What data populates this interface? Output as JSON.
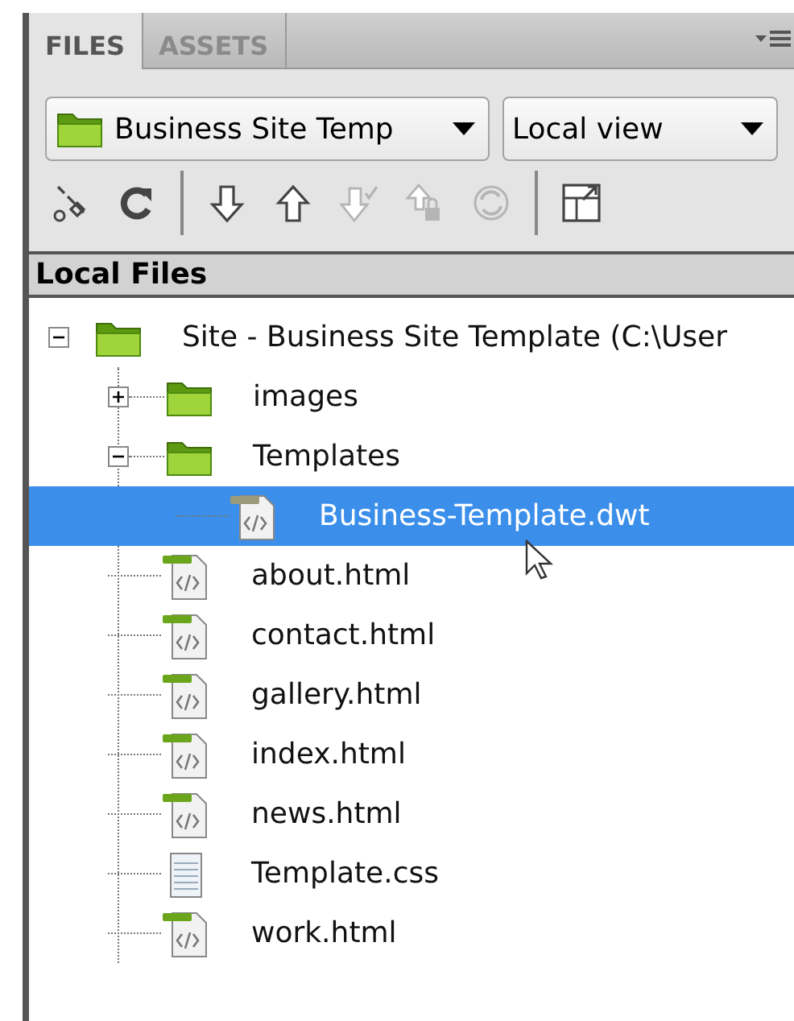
{
  "tabs": [
    {
      "label": "FILES",
      "selected": true
    },
    {
      "label": "ASSETS",
      "selected": false
    }
  ],
  "site_select": {
    "value": "Business Site Temp"
  },
  "view_select": {
    "value": "Local view"
  },
  "toolbar": [
    {
      "kind": "connect",
      "disabled": false
    },
    {
      "kind": "refresh",
      "disabled": false
    },
    {
      "kind": "separator"
    },
    {
      "kind": "get",
      "disabled": false
    },
    {
      "kind": "put",
      "disabled": false
    },
    {
      "kind": "checkout",
      "disabled": true
    },
    {
      "kind": "checkin",
      "disabled": true
    },
    {
      "kind": "sync",
      "disabled": true
    },
    {
      "kind": "separator"
    },
    {
      "kind": "expand",
      "disabled": false
    }
  ],
  "tree_header": "Local Files",
  "tree": [
    {
      "kind": "folder",
      "name": "Site - Business Site Template (C:\\User",
      "expanded": true,
      "selected": false,
      "children": [
        {
          "kind": "folder",
          "name": "images",
          "expanded": false,
          "selected": false
        },
        {
          "kind": "folder",
          "name": "Templates",
          "expanded": true,
          "selected": false,
          "children": [
            {
              "kind": "template",
              "name": "Business-Template.dwt",
              "selected": true
            }
          ]
        },
        {
          "kind": "html",
          "name": "about.html",
          "selected": false
        },
        {
          "kind": "html",
          "name": "contact.html",
          "selected": false
        },
        {
          "kind": "html",
          "name": "gallery.html",
          "selected": false
        },
        {
          "kind": "html",
          "name": "index.html",
          "selected": false
        },
        {
          "kind": "html",
          "name": "news.html",
          "selected": false
        },
        {
          "kind": "css",
          "name": "Template.css",
          "selected": false
        },
        {
          "kind": "html",
          "name": "work.html",
          "selected": false
        }
      ]
    }
  ]
}
